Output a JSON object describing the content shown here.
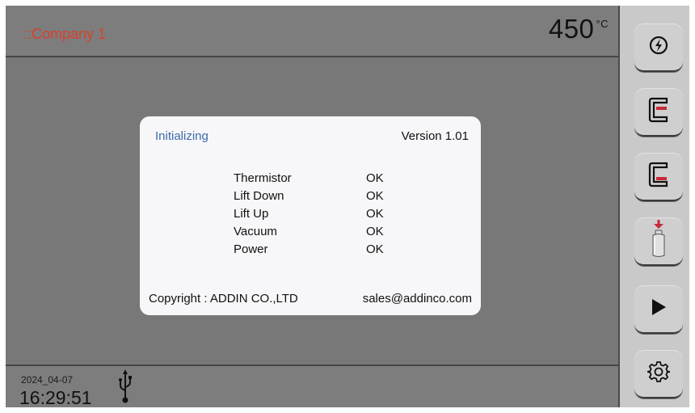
{
  "header": {
    "company": "::Company 1",
    "temperature": "450",
    "temperature_unit": "°C"
  },
  "dialog": {
    "title": "Initializing",
    "version": "Version 1.01",
    "checks": [
      {
        "name": "Thermistor",
        "status": "OK"
      },
      {
        "name": "Lift Down",
        "status": "OK"
      },
      {
        "name": "Lift Up",
        "status": "OK"
      },
      {
        "name": "Vacuum",
        "status": "OK"
      },
      {
        "name": "Power",
        "status": "OK"
      }
    ],
    "copyright": "Copyright : ADDIN CO.,LTD",
    "email": "sales@addinco.com"
  },
  "footer": {
    "date": "2024_04-07",
    "time": "16:29:51",
    "usb_icon": "usb-icon"
  },
  "sidebar": {
    "buttons": [
      {
        "name": "power-button",
        "icon": "power-icon"
      },
      {
        "name": "lift-up-button",
        "icon": "lift-up-icon"
      },
      {
        "name": "lift-down-button",
        "icon": "lift-down-icon"
      },
      {
        "name": "vacuum-button",
        "icon": "vacuum-bottle-icon"
      },
      {
        "name": "start-button",
        "icon": "play-icon"
      },
      {
        "name": "settings-button",
        "icon": "gear-icon"
      }
    ]
  },
  "colors": {
    "accent_red": "#d9402c",
    "title_blue": "#3d6aa8",
    "background": "#787878",
    "sidebar": "#c9c9c9"
  }
}
